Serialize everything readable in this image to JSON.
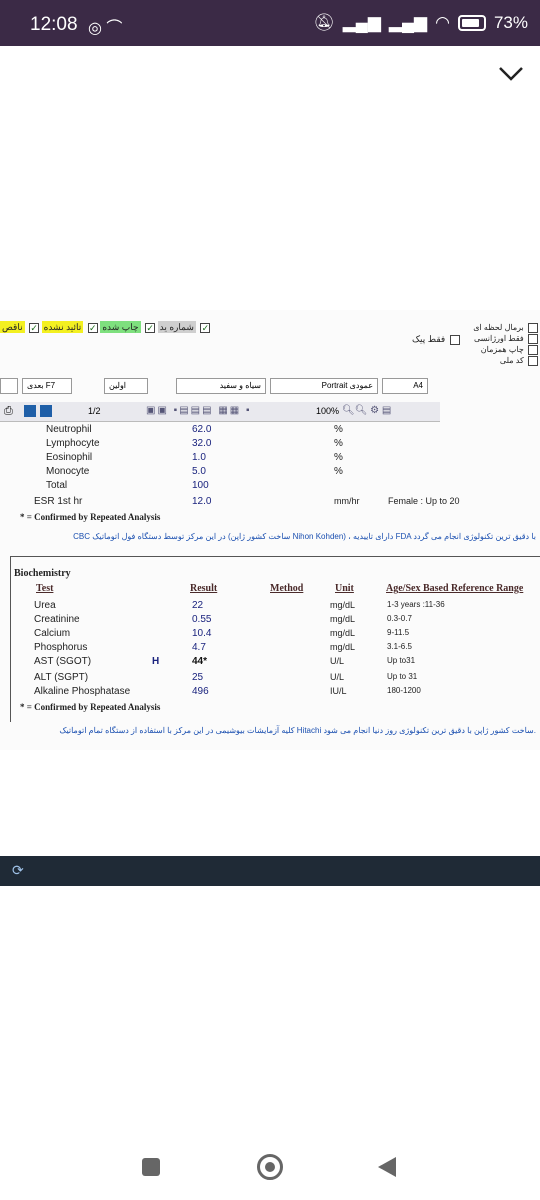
{
  "status_bar": {
    "time": "12:08",
    "battery": "73%"
  },
  "doc": {
    "checkboxes_left": [
      {
        "label": "شماره ید",
        "checked": false
      },
      {
        "label": "چاپ شده",
        "checked": true
      },
      {
        "label": "تائید نشده",
        "checked": true
      },
      {
        "label": "ناقص",
        "checked": true
      }
    ],
    "checkboxes_right": [
      {
        "label": "برمال لحظه ای",
        "checked": false
      },
      {
        "label": "فقط اورژانسی",
        "checked": false
      },
      {
        "label": "چاپ همزمان",
        "checked": false
      },
      {
        "label": "کد ملی",
        "checked": false
      }
    ],
    "only_peak": "فقط پیک",
    "nav": {
      "first": "اولین",
      "next": "بعدی F7"
    },
    "color_mode": "سیاه و سفید",
    "orientation": "Portrait عمودی",
    "paper": "A4",
    "page_indicator": "1/2",
    "zoom": "100%",
    "cbc_rows": [
      {
        "name": "Neutrophil",
        "result": "62.0",
        "unit": "%"
      },
      {
        "name": "Lymphocyte",
        "result": "32.0",
        "unit": "%"
      },
      {
        "name": "Eosinophil",
        "result": "1.0",
        "unit": "%"
      },
      {
        "name": "Monocyte",
        "result": "5.0",
        "unit": "%"
      },
      {
        "name": "Total",
        "result": "100",
        "unit": ""
      },
      {
        "name": "ESR 1st hr",
        "result": "12.0",
        "unit": "mm/hr",
        "range": "Female : Up to 20"
      }
    ],
    "confirmed_note": "* = Confirmed by Repeated Analysis",
    "cbc_persian": "CBC در این مرکز توسط دستگاه فول اتوماتیک (ساخت کشور ژاپن Nihon Kohden) ، دارای تاییدیه FDA با دقیق ترین تکنولوژی انجام می گردد",
    "biochem_title": "Biochemistry",
    "headers": {
      "test": "Test",
      "result": "Result",
      "method": "Method",
      "unit": "Unit",
      "range": "Age/Sex Based Reference Range"
    },
    "biochem_rows": [
      {
        "name": "Urea",
        "flag": "",
        "result": "22",
        "unit": "mg/dL",
        "range": "1-3 years :11-36"
      },
      {
        "name": "Creatinine",
        "flag": "",
        "result": "0.55",
        "unit": "mg/dL",
        "range": "0.3-0.7"
      },
      {
        "name": "Calcium",
        "flag": "",
        "result": "10.4",
        "unit": "mg/dL",
        "range": "9-11.5"
      },
      {
        "name": "Phosphorus",
        "flag": "",
        "result": "4.7",
        "unit": "mg/dL",
        "range": "3.1-6.5"
      },
      {
        "name": "AST (SGOT)",
        "flag": "H",
        "result": "44*",
        "unit": "U/L",
        "range": "Up to31"
      },
      {
        "name": "ALT (SGPT)",
        "flag": "",
        "result": "25",
        "unit": "U/L",
        "range": "Up to 31"
      },
      {
        "name": "Alkaline Phosphatase",
        "flag": "",
        "result": "496",
        "unit": "IU/L",
        "range": "180-1200"
      }
    ],
    "biochem_note": "* = Confirmed by Repeated Analysis",
    "biochem_persian": "کلیه آزمایشات بیوشیمی در این مرکز با استفاده از دستگاه تمام اتوماتیک Hitachi ساخت کشور ژاپن با دقیق ترین تکنولوژی روز دنیا انجام می شود."
  }
}
